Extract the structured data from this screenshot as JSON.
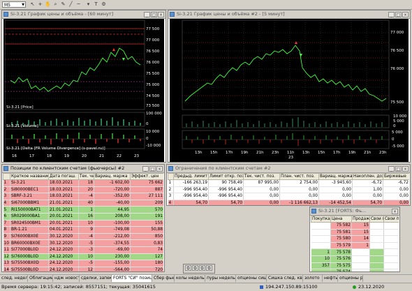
{
  "toolbar": {
    "timeframe": "M5"
  },
  "chart1": {
    "title": "Si-3.21 График цены и объёма - [60 минут]",
    "price_labels": [
      "77 500",
      "77 000",
      "76 500",
      "76 000",
      "75 500",
      "75 000",
      "74 500",
      "74 000",
      "73 500"
    ],
    "price_label": "Si-3.21 [Price]",
    "volume_label": "Si-3.21 [Volume]",
    "delta_label": "Si-3.21 [Delta [FR Volume Divergence] (s-pavel.ru)]",
    "vol_axis": [
      "100 000",
      "50 000",
      "0"
    ],
    "delta_axis": [
      "10 000",
      "0",
      "-10 000"
    ],
    "dates": [
      "16",
      "17",
      "18",
      "19",
      "20",
      "21",
      "22",
      "23"
    ]
  },
  "chart2": {
    "title": "Si-3.21 График цены и объёма #2 - [5 минут]",
    "price_labels": [
      "77 000",
      "76 500",
      "76 000",
      "75 500"
    ],
    "vol_axis": [
      "10 000",
      "5 000",
      "0"
    ],
    "delta_axis": [
      "5 000",
      "0",
      "-5 000"
    ],
    "times": [
      "13h",
      "15h",
      "17h",
      "19h",
      "21h",
      "23h",
      "11h",
      "13h",
      "15h",
      "17h",
      "19h",
      "21h",
      "23h"
    ],
    "date_marker": "23"
  },
  "positions": {
    "title": "Позиции по клиентским счетам (фьючерсы) #2",
    "headers": [
      "",
      "Краткое название",
      "Дата погаш.",
      "Тек. чист.",
      "Вариац. маржа",
      "Эффект. цен"
    ],
    "rows": [
      {
        "n": "1",
        "name": "Si-3.21",
        "date": "18.03.2021",
        "net": "18",
        "vm": "-1 602,00",
        "price": "75 662",
        "color": "red"
      },
      {
        "n": "2",
        "name": "Si80000BEC1",
        "date": "18.03.2021",
        "net": "20",
        "vm": "-720,00",
        "price": "887",
        "color": "red"
      },
      {
        "n": "3",
        "name": "SBRF-3.21",
        "date": "18.03.2021",
        "net": "-4",
        "vm": "-352,00",
        "price": "27 111",
        "color": "red"
      },
      {
        "n": "4",
        "name": "Si67000BBM1",
        "date": "21.01.2021",
        "net": "40",
        "vm": "-40,00",
        "price": "209",
        "color": "red"
      },
      {
        "n": "5",
        "name": "RI150000BAT1",
        "date": "21.01.2021",
        "net": "1",
        "vm": "44,95",
        "price": "570",
        "color": "green"
      },
      {
        "n": "6",
        "name": "SR029000BA1",
        "date": "20.01.2021",
        "net": "16",
        "vm": "208,00",
        "price": "191",
        "color": "green"
      },
      {
        "n": "7",
        "name": "SR024500BM1",
        "date": "20.01.2021",
        "net": "10",
        "vm": "-100,00",
        "price": "155",
        "color": "red"
      },
      {
        "n": "8",
        "name": "BR-1.21",
        "date": "04.01.2021",
        "net": "9",
        "vm": "-749,08",
        "price": "50,88",
        "color": "red"
      },
      {
        "n": "9",
        "name": "Si76000BX0E",
        "date": "30.12.2020",
        "net": "-4",
        "vm": "-212,00",
        "price": "850",
        "color": "red"
      },
      {
        "n": "10",
        "name": "BR60000BX0E",
        "date": "30.12.2020",
        "net": "-5",
        "vm": "-374,55",
        "price": "0,83",
        "color": "red"
      },
      {
        "n": "11",
        "name": "Si77000BL0D",
        "date": "24.12.2020",
        "net": "-3",
        "vm": "-69,00",
        "price": "74",
        "color": "red"
      },
      {
        "n": "12",
        "name": "Si76000BL0D",
        "date": "24.12.2020",
        "net": "10",
        "vm": "230,00",
        "price": "127",
        "color": "green"
      },
      {
        "n": "13",
        "name": "Si75500BX0D",
        "date": "24.12.2020",
        "net": "-5",
        "vm": "-155,00",
        "price": "180",
        "color": "red"
      },
      {
        "n": "14",
        "name": "Si75500BL0D",
        "date": "24.12.2020",
        "net": "12",
        "vm": "-564,00",
        "price": "720",
        "color": "red"
      },
      {
        "n": "15",
        "name": "Si74000BL0D",
        "date": "24.12.2020",
        "net": "-10",
        "vm": "690,00",
        "price": "1 672",
        "color": "green"
      },
      {
        "n": "16",
        "name": "BR60000ZBL0",
        "date": "23.12.2020",
        "net": "0",
        "vm": "0,00",
        "price": "0",
        "color": "white"
      }
    ]
  },
  "limits": {
    "title": "Ограничения по клиентским счетам #2",
    "headers": [
      "Предыд. лимит",
      "Лимит откр. поз.",
      "Тек. чист. поз.",
      "План. чист. поз.",
      "Вариац. маржа",
      "Накоплен. доход",
      "Биржевые"
    ],
    "rows": [
      {
        "n": "1",
        "c": [
          "-166 263,19",
          "90 758,49",
          "87 995,00",
          "2 754,00",
          "-3 945,60",
          "-6,72",
          "-6,72"
        ]
      },
      {
        "n": "2",
        "c": [
          "-996 954,40",
          "-996 954,40",
          "0,00",
          "0,00",
          "0,00",
          "1,00",
          "0,00"
        ]
      },
      {
        "n": "3",
        "c": [
          "-996 954,40",
          "-996 954,40",
          "0,00",
          "0,00",
          "0,00",
          "0,00",
          "0,00"
        ]
      },
      {
        "n": "4",
        "c": [
          "54,70",
          "54,70",
          "0,00",
          "-1 116 662,13",
          "-14 452,54",
          "54,70",
          "0,00"
        ]
      }
    ]
  },
  "glass": {
    "title": "Si-3.21 [FORTS: Фь...",
    "headers": [
      "Покупка",
      "Цена",
      "Продажа",
      "Свои по",
      "Свои пр"
    ],
    "rows": [
      {
        "buy": "",
        "price": "75 582",
        "sell": "15",
        "side": "sell"
      },
      {
        "buy": "",
        "price": "75 581",
        "sell": "15",
        "side": "sell"
      },
      {
        "buy": "",
        "price": "75 580",
        "sell": "14",
        "side": "sell"
      },
      {
        "buy": "",
        "price": "75 579",
        "sell": "1",
        "side": "sell"
      },
      {
        "buy": "1",
        "price": "75 578",
        "sell": "",
        "side": "buy"
      },
      {
        "buy": "10",
        "price": "75 576",
        "sell": "",
        "side": "buy"
      },
      {
        "buy": "357",
        "price": "75 575",
        "sell": "",
        "side": "buy"
      },
      {
        "buy": "",
        "price": "75 574",
        "sell": "",
        "side": "buy"
      }
    ]
  },
  "tabs": [
    "след. неделя",
    "Облигации",
    "ндж новости",
    "сделки, запеки",
    "FORTS \"СИ\" позиции",
    "Сбер фьюч",
    "колы неделька",
    "пуры неделька",
    "опционы сишка",
    "Сишка след. квартал",
    "золото",
    "нефть",
    "опционы ртс"
  ],
  "status": {
    "server_time": "Время сервера: 19:15:42; записей: 8557151; текущая: 35041615",
    "connection": "194.247.150.89:15100",
    "date": "23.12.2020"
  }
}
